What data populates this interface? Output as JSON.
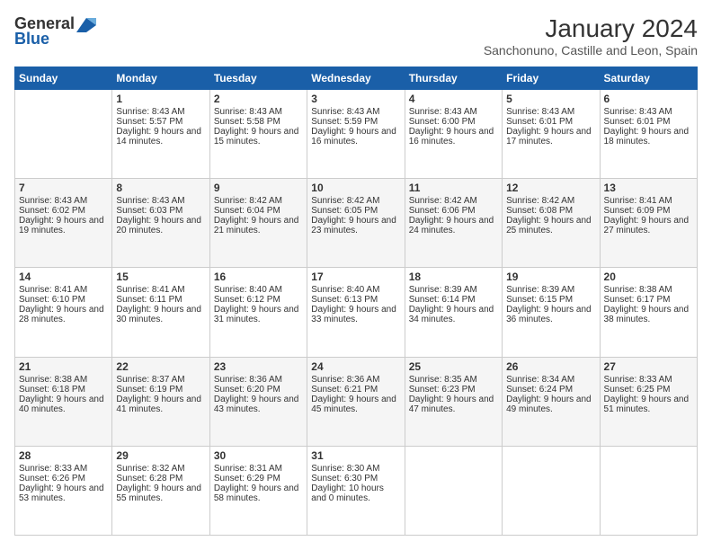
{
  "logo": {
    "general": "General",
    "blue": "Blue"
  },
  "title": "January 2024",
  "location": "Sanchonuno, Castille and Leon, Spain",
  "headers": [
    "Sunday",
    "Monday",
    "Tuesday",
    "Wednesday",
    "Thursday",
    "Friday",
    "Saturday"
  ],
  "weeks": [
    [
      {
        "day": "",
        "sunrise": "",
        "sunset": "",
        "daylight": ""
      },
      {
        "day": "1",
        "sunrise": "Sunrise: 8:43 AM",
        "sunset": "Sunset: 5:57 PM",
        "daylight": "Daylight: 9 hours and 14 minutes."
      },
      {
        "day": "2",
        "sunrise": "Sunrise: 8:43 AM",
        "sunset": "Sunset: 5:58 PM",
        "daylight": "Daylight: 9 hours and 15 minutes."
      },
      {
        "day": "3",
        "sunrise": "Sunrise: 8:43 AM",
        "sunset": "Sunset: 5:59 PM",
        "daylight": "Daylight: 9 hours and 16 minutes."
      },
      {
        "day": "4",
        "sunrise": "Sunrise: 8:43 AM",
        "sunset": "Sunset: 6:00 PM",
        "daylight": "Daylight: 9 hours and 16 minutes."
      },
      {
        "day": "5",
        "sunrise": "Sunrise: 8:43 AM",
        "sunset": "Sunset: 6:01 PM",
        "daylight": "Daylight: 9 hours and 17 minutes."
      },
      {
        "day": "6",
        "sunrise": "Sunrise: 8:43 AM",
        "sunset": "Sunset: 6:01 PM",
        "daylight": "Daylight: 9 hours and 18 minutes."
      }
    ],
    [
      {
        "day": "7",
        "sunrise": "Sunrise: 8:43 AM",
        "sunset": "Sunset: 6:02 PM",
        "daylight": "Daylight: 9 hours and 19 minutes."
      },
      {
        "day": "8",
        "sunrise": "Sunrise: 8:43 AM",
        "sunset": "Sunset: 6:03 PM",
        "daylight": "Daylight: 9 hours and 20 minutes."
      },
      {
        "day": "9",
        "sunrise": "Sunrise: 8:42 AM",
        "sunset": "Sunset: 6:04 PM",
        "daylight": "Daylight: 9 hours and 21 minutes."
      },
      {
        "day": "10",
        "sunrise": "Sunrise: 8:42 AM",
        "sunset": "Sunset: 6:05 PM",
        "daylight": "Daylight: 9 hours and 23 minutes."
      },
      {
        "day": "11",
        "sunrise": "Sunrise: 8:42 AM",
        "sunset": "Sunset: 6:06 PM",
        "daylight": "Daylight: 9 hours and 24 minutes."
      },
      {
        "day": "12",
        "sunrise": "Sunrise: 8:42 AM",
        "sunset": "Sunset: 6:08 PM",
        "daylight": "Daylight: 9 hours and 25 minutes."
      },
      {
        "day": "13",
        "sunrise": "Sunrise: 8:41 AM",
        "sunset": "Sunset: 6:09 PM",
        "daylight": "Daylight: 9 hours and 27 minutes."
      }
    ],
    [
      {
        "day": "14",
        "sunrise": "Sunrise: 8:41 AM",
        "sunset": "Sunset: 6:10 PM",
        "daylight": "Daylight: 9 hours and 28 minutes."
      },
      {
        "day": "15",
        "sunrise": "Sunrise: 8:41 AM",
        "sunset": "Sunset: 6:11 PM",
        "daylight": "Daylight: 9 hours and 30 minutes."
      },
      {
        "day": "16",
        "sunrise": "Sunrise: 8:40 AM",
        "sunset": "Sunset: 6:12 PM",
        "daylight": "Daylight: 9 hours and 31 minutes."
      },
      {
        "day": "17",
        "sunrise": "Sunrise: 8:40 AM",
        "sunset": "Sunset: 6:13 PM",
        "daylight": "Daylight: 9 hours and 33 minutes."
      },
      {
        "day": "18",
        "sunrise": "Sunrise: 8:39 AM",
        "sunset": "Sunset: 6:14 PM",
        "daylight": "Daylight: 9 hours and 34 minutes."
      },
      {
        "day": "19",
        "sunrise": "Sunrise: 8:39 AM",
        "sunset": "Sunset: 6:15 PM",
        "daylight": "Daylight: 9 hours and 36 minutes."
      },
      {
        "day": "20",
        "sunrise": "Sunrise: 8:38 AM",
        "sunset": "Sunset: 6:17 PM",
        "daylight": "Daylight: 9 hours and 38 minutes."
      }
    ],
    [
      {
        "day": "21",
        "sunrise": "Sunrise: 8:38 AM",
        "sunset": "Sunset: 6:18 PM",
        "daylight": "Daylight: 9 hours and 40 minutes."
      },
      {
        "day": "22",
        "sunrise": "Sunrise: 8:37 AM",
        "sunset": "Sunset: 6:19 PM",
        "daylight": "Daylight: 9 hours and 41 minutes."
      },
      {
        "day": "23",
        "sunrise": "Sunrise: 8:36 AM",
        "sunset": "Sunset: 6:20 PM",
        "daylight": "Daylight: 9 hours and 43 minutes."
      },
      {
        "day": "24",
        "sunrise": "Sunrise: 8:36 AM",
        "sunset": "Sunset: 6:21 PM",
        "daylight": "Daylight: 9 hours and 45 minutes."
      },
      {
        "day": "25",
        "sunrise": "Sunrise: 8:35 AM",
        "sunset": "Sunset: 6:23 PM",
        "daylight": "Daylight: 9 hours and 47 minutes."
      },
      {
        "day": "26",
        "sunrise": "Sunrise: 8:34 AM",
        "sunset": "Sunset: 6:24 PM",
        "daylight": "Daylight: 9 hours and 49 minutes."
      },
      {
        "day": "27",
        "sunrise": "Sunrise: 8:33 AM",
        "sunset": "Sunset: 6:25 PM",
        "daylight": "Daylight: 9 hours and 51 minutes."
      }
    ],
    [
      {
        "day": "28",
        "sunrise": "Sunrise: 8:33 AM",
        "sunset": "Sunset: 6:26 PM",
        "daylight": "Daylight: 9 hours and 53 minutes."
      },
      {
        "day": "29",
        "sunrise": "Sunrise: 8:32 AM",
        "sunset": "Sunset: 6:28 PM",
        "daylight": "Daylight: 9 hours and 55 minutes."
      },
      {
        "day": "30",
        "sunrise": "Sunrise: 8:31 AM",
        "sunset": "Sunset: 6:29 PM",
        "daylight": "Daylight: 9 hours and 58 minutes."
      },
      {
        "day": "31",
        "sunrise": "Sunrise: 8:30 AM",
        "sunset": "Sunset: 6:30 PM",
        "daylight": "Daylight: 10 hours and 0 minutes."
      },
      {
        "day": "",
        "sunrise": "",
        "sunset": "",
        "daylight": ""
      },
      {
        "day": "",
        "sunrise": "",
        "sunset": "",
        "daylight": ""
      },
      {
        "day": "",
        "sunrise": "",
        "sunset": "",
        "daylight": ""
      }
    ]
  ]
}
